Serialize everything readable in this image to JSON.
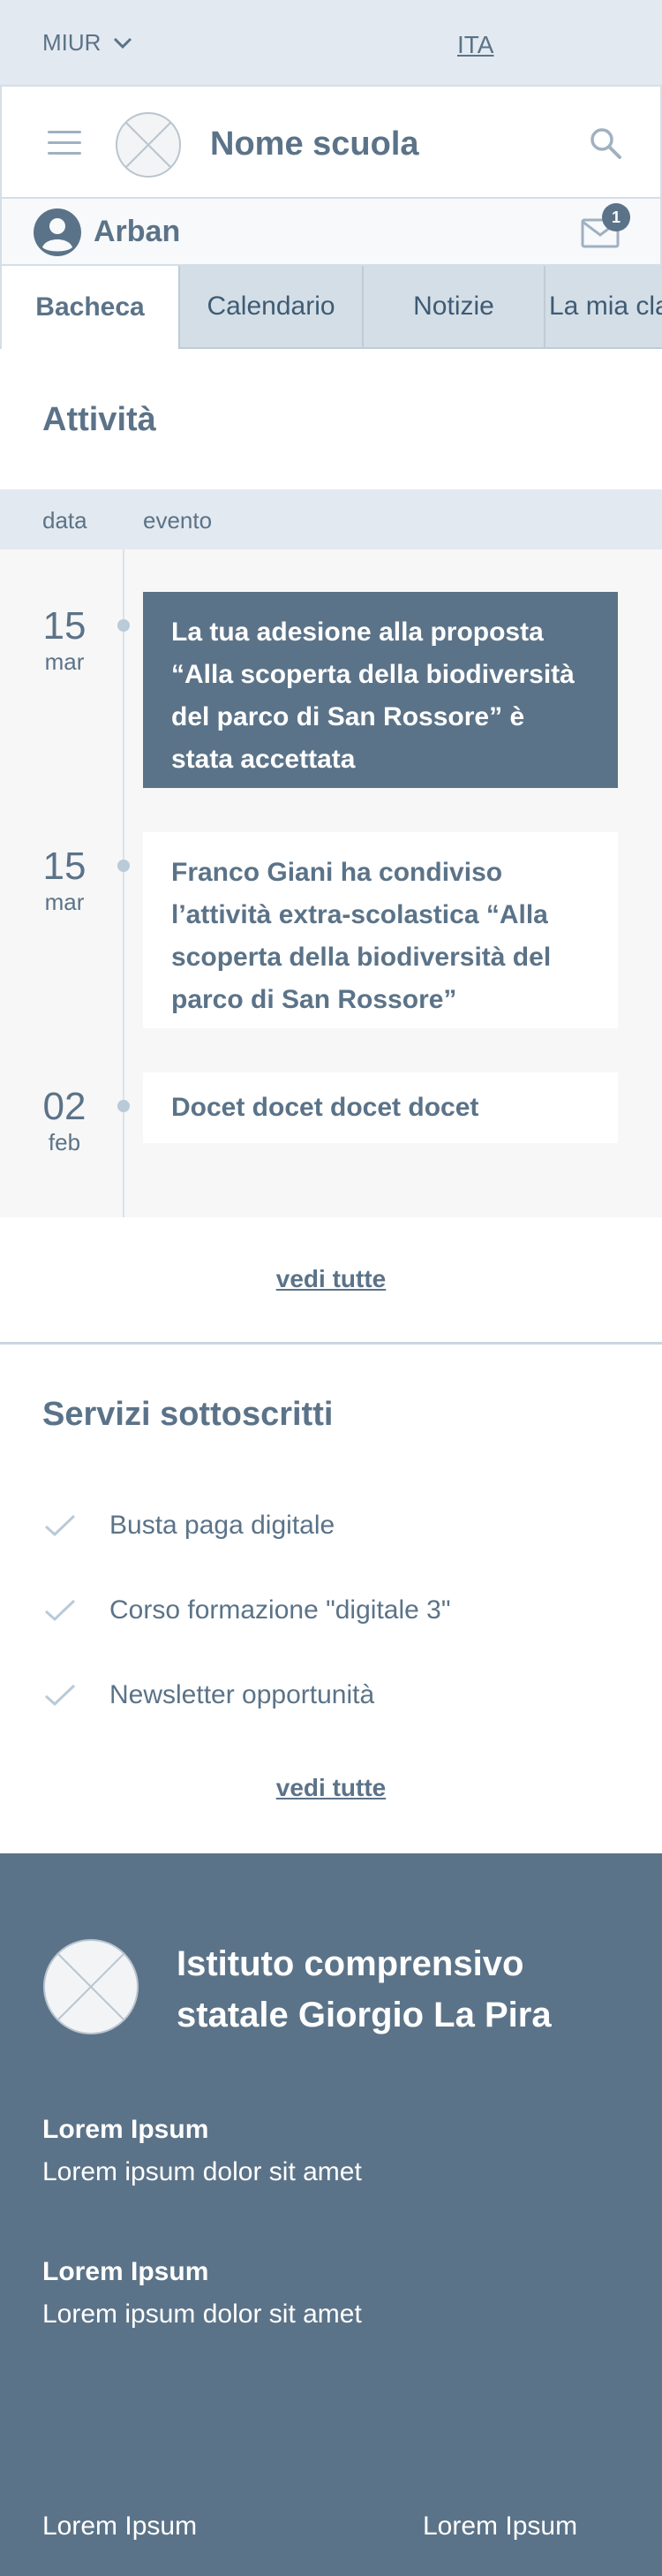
{
  "topbar": {
    "brand": "MIUR",
    "language": "ITA"
  },
  "header": {
    "school_name": "Nome scuola"
  },
  "user": {
    "name": "Arban",
    "notifications": "1"
  },
  "tabs": [
    {
      "label": "Bacheca",
      "active": true
    },
    {
      "label": "Calendario"
    },
    {
      "label": "Notizie"
    },
    {
      "label": "La mia classe"
    }
  ],
  "activities": {
    "title": "Attività",
    "columns": {
      "date": "data",
      "event": "evento"
    },
    "items": [
      {
        "day": "15",
        "month": "mar",
        "text": "La tua adesione alla proposta “Alla scoperta della biodiversità del parco di San Rossore” è stata accettata"
      },
      {
        "day": "15",
        "month": "mar",
        "text": "Franco Giani ha condiviso l’attività extra-scolastica “Alla scoperta della biodiversità del parco di San Rossore”"
      },
      {
        "day": "02",
        "month": "feb",
        "text": "Docet docet docet docet"
      }
    ],
    "see_all": "vedi tutte"
  },
  "services": {
    "title": "Servizi sottoscritti",
    "items": [
      "Busta paga digitale",
      "Corso formazione \"digitale 3\"",
      "Newsletter opportunità"
    ],
    "see_all": "vedi tutte"
  },
  "footer": {
    "institute": "Istituto comprensivo statale Giorgio La Pira",
    "blocks": [
      {
        "heading": "Lorem Ipsum",
        "text": "Lorem ipsum dolor sit amet"
      },
      {
        "heading": "Lorem Ipsum",
        "text": "Lorem ipsum dolor sit amet"
      }
    ],
    "links": [
      "Lorem Ipsum",
      "Lorem Ipsum"
    ]
  },
  "colors": {
    "primary": "#5b7388",
    "light_bg": "#e3e9f0",
    "tab_bg": "#d3dee7"
  }
}
